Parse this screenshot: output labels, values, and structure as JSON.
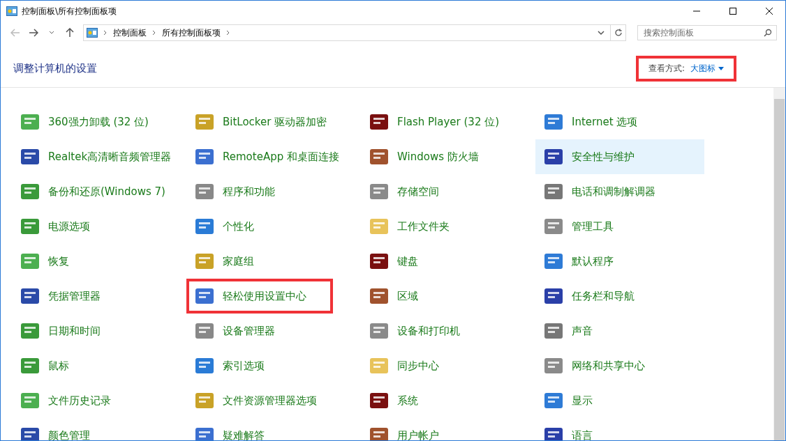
{
  "window": {
    "title": "控制面板\\所有控制面板项"
  },
  "address": {
    "crumbs": [
      "控制面板",
      "所有控制面板项"
    ]
  },
  "search": {
    "placeholder": "搜索控制面板"
  },
  "header": {
    "title": "调整计算机的设置",
    "view_label": "查看方式:",
    "view_value": "大图标",
    "highlighted": true
  },
  "items": [
    {
      "label": "360强力卸载 (32 位)",
      "hovered": false,
      "highlighted": false
    },
    {
      "label": "BitLocker 驱动器加密",
      "hovered": false,
      "highlighted": false
    },
    {
      "label": "Flash Player (32 位)",
      "hovered": false,
      "highlighted": false
    },
    {
      "label": "Internet 选项",
      "hovered": false,
      "highlighted": false
    },
    {
      "label": "Realtek高清晰音频管理器",
      "hovered": false,
      "highlighted": false
    },
    {
      "label": "RemoteApp 和桌面连接",
      "hovered": false,
      "highlighted": false
    },
    {
      "label": "Windows 防火墙",
      "hovered": false,
      "highlighted": false
    },
    {
      "label": "安全性与维护",
      "hovered": true,
      "highlighted": false
    },
    {
      "label": "备份和还原(Windows 7)",
      "hovered": false,
      "highlighted": false
    },
    {
      "label": "程序和功能",
      "hovered": false,
      "highlighted": false
    },
    {
      "label": "存储空间",
      "hovered": false,
      "highlighted": false
    },
    {
      "label": "电话和调制解调器",
      "hovered": false,
      "highlighted": false
    },
    {
      "label": "电源选项",
      "hovered": false,
      "highlighted": false
    },
    {
      "label": "个性化",
      "hovered": false,
      "highlighted": false
    },
    {
      "label": "工作文件夹",
      "hovered": false,
      "highlighted": false
    },
    {
      "label": "管理工具",
      "hovered": false,
      "highlighted": false
    },
    {
      "label": "恢复",
      "hovered": false,
      "highlighted": false
    },
    {
      "label": "家庭组",
      "hovered": false,
      "highlighted": false
    },
    {
      "label": "键盘",
      "hovered": false,
      "highlighted": false
    },
    {
      "label": "默认程序",
      "hovered": false,
      "highlighted": false
    },
    {
      "label": "凭据管理器",
      "hovered": false,
      "highlighted": false
    },
    {
      "label": "轻松使用设置中心",
      "hovered": false,
      "highlighted": true
    },
    {
      "label": "区域",
      "hovered": false,
      "highlighted": false
    },
    {
      "label": "任务栏和导航",
      "hovered": false,
      "highlighted": false
    },
    {
      "label": "日期和时间",
      "hovered": false,
      "highlighted": false
    },
    {
      "label": "设备管理器",
      "hovered": false,
      "highlighted": false
    },
    {
      "label": "设备和打印机",
      "hovered": false,
      "highlighted": false
    },
    {
      "label": "声音",
      "hovered": false,
      "highlighted": false
    },
    {
      "label": "鼠标",
      "hovered": false,
      "highlighted": false
    },
    {
      "label": "索引选项",
      "hovered": false,
      "highlighted": false
    },
    {
      "label": "同步中心",
      "hovered": false,
      "highlighted": false
    },
    {
      "label": "网络和共享中心",
      "hovered": false,
      "highlighted": false
    },
    {
      "label": "文件历史记录",
      "hovered": false,
      "highlighted": false
    },
    {
      "label": "文件资源管理器选项",
      "hovered": false,
      "highlighted": false
    },
    {
      "label": "系统",
      "hovered": false,
      "highlighted": false
    },
    {
      "label": "显示",
      "hovered": false,
      "highlighted": false
    },
    {
      "label": "颜色管理",
      "hovered": false,
      "highlighted": false
    },
    {
      "label": "疑难解答",
      "hovered": false,
      "highlighted": false
    },
    {
      "label": "用户帐户",
      "hovered": false,
      "highlighted": false
    },
    {
      "label": "语言",
      "hovered": false,
      "highlighted": false
    }
  ]
}
